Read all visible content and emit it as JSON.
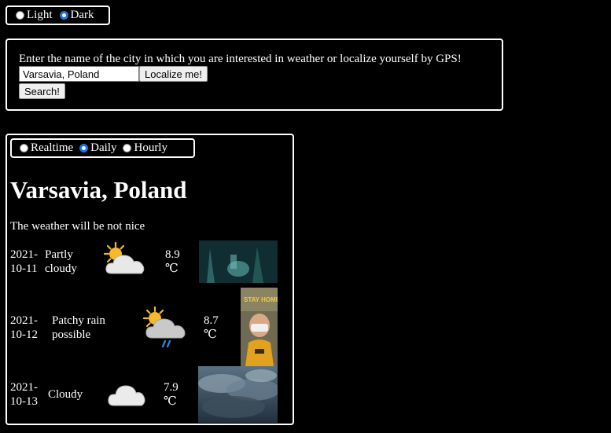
{
  "theme": {
    "options": [
      "Light",
      "Dark"
    ],
    "selected": "Dark"
  },
  "search": {
    "prompt": "Enter the name of the city in which you are interested in weather or localize yourself by GPS!",
    "city_value": "Varsavia, Poland",
    "localize_label": "Localize me!",
    "search_label": "Search!"
  },
  "mode": {
    "options": [
      "Realtime",
      "Daily",
      "Hourly"
    ],
    "selected": "Daily"
  },
  "location": "Varsavia, Poland",
  "summary": "The weather will be not nice",
  "days": [
    {
      "date_line1": "2021-",
      "date_line2": "10-11",
      "condition_line1": "Partly",
      "condition_line2": "cloudy",
      "icon": "partly-cloudy-icon",
      "temp_line1": "8.9",
      "temp_line2": "℃"
    },
    {
      "date_line1": "2021-",
      "date_line2": "10-12",
      "condition_line1": "Patchy rain",
      "condition_line2": "possible",
      "icon": "patchy-rain-icon",
      "temp_line1": "8.7",
      "temp_line2": "℃"
    },
    {
      "date_line1": "2021-",
      "date_line2": "10-13",
      "condition_line1": "Cloudy",
      "condition_line2": "",
      "icon": "cloudy-icon",
      "temp_line1": "7.9",
      "temp_line2": "℃"
    }
  ],
  "colors": {
    "background": "#000000",
    "text": "#ffffff",
    "radio_selected": "#1a73e8",
    "sun": "#f5b82e",
    "cloud": "#e8e8e8",
    "rain": "#2f7fd6"
  }
}
